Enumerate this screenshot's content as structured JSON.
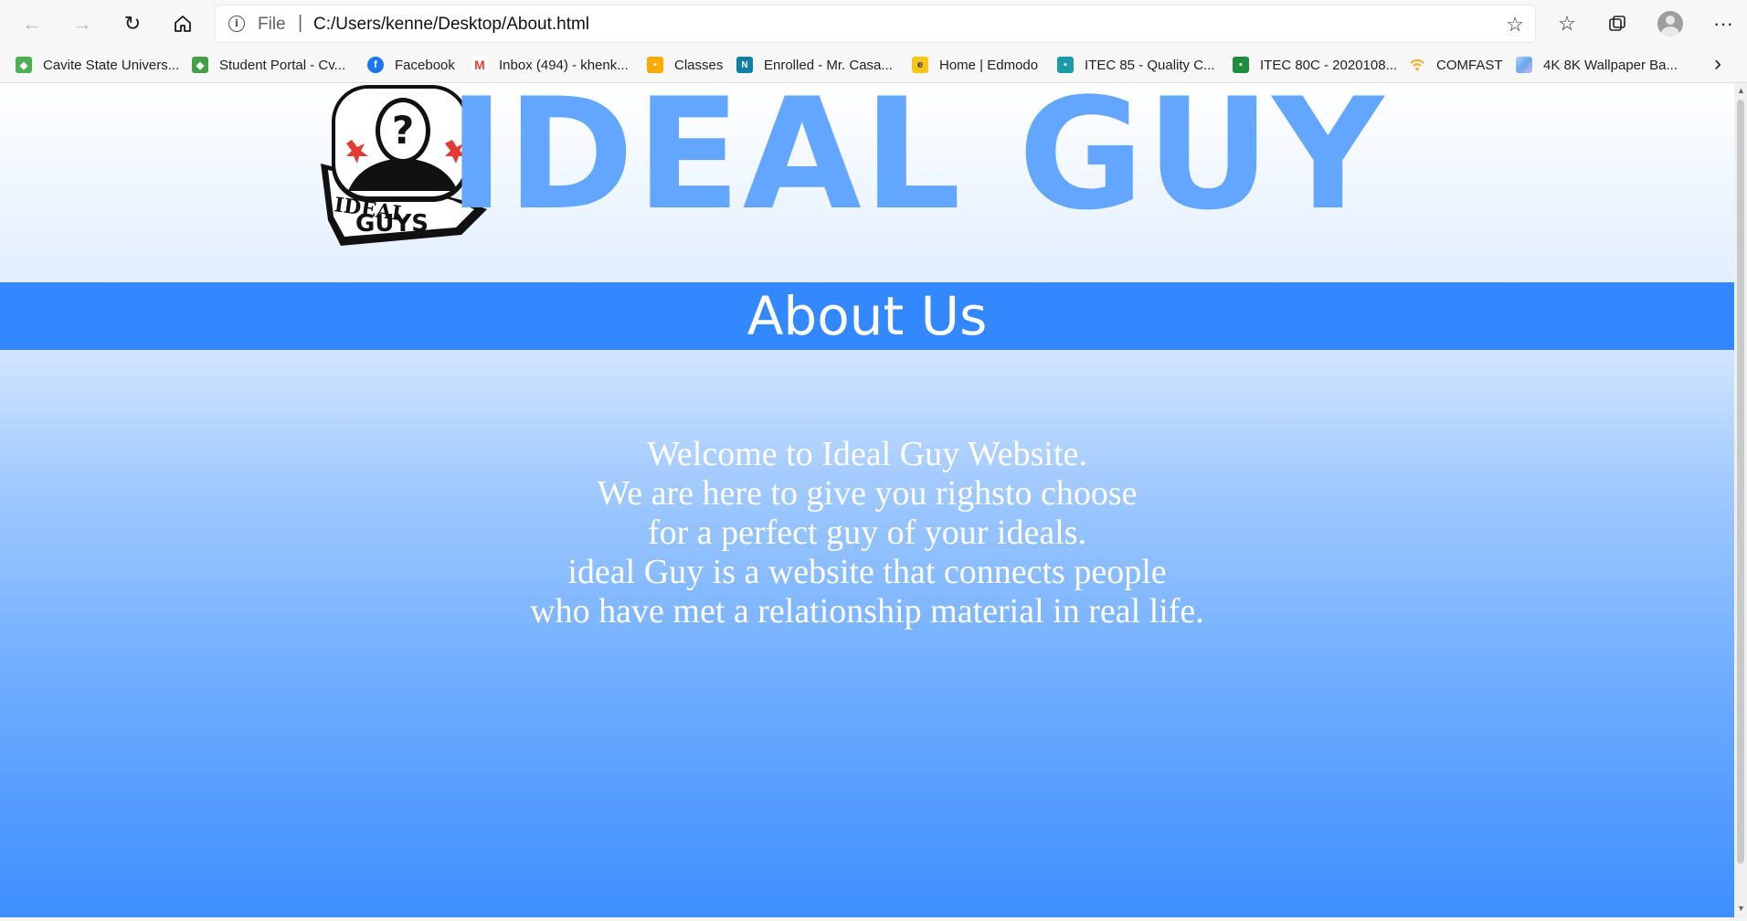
{
  "browser": {
    "address": {
      "scheme": "File",
      "separator": "|",
      "url": "C:/Users/kenne/Desktop/About.html"
    },
    "icons": {
      "back": "back-arrow-icon",
      "forward": "forward-arrow-icon",
      "refresh": "refresh-icon",
      "home": "home-icon",
      "info": "info-icon",
      "add_favorite": "star-add-icon",
      "favorites": "favorites-icon",
      "collections": "collections-icon",
      "profile": "profile-avatar-icon",
      "menu": "more-menu-icon"
    },
    "favorites": [
      {
        "label": "Cavite State Univers...",
        "icon": "cvsu-icon",
        "color": "#4caf50"
      },
      {
        "label": "Student Portal - Cv...",
        "icon": "portal-icon",
        "color": "#43a047"
      },
      {
        "label": "Facebook",
        "icon": "facebook-icon",
        "color": "#1877f2"
      },
      {
        "label": "Inbox (494) - khenk...",
        "icon": "gmail-icon",
        "color": "#ea4335"
      },
      {
        "label": "Classes",
        "icon": "classroom-icon",
        "color": "#f9ab00"
      },
      {
        "label": "Enrolled - Mr. Casa...",
        "icon": "onenote-icon",
        "color": "#0f7fa6"
      },
      {
        "label": "Home | Edmodo",
        "icon": "edmodo-icon",
        "color": "#f5c518"
      },
      {
        "label": "ITEC 85 - Quality C...",
        "icon": "classroom-icon",
        "color": "#1b9aaa"
      },
      {
        "label": "ITEC 80C - 2020108...",
        "icon": "classroom-icon",
        "color": "#1e8e3e"
      },
      {
        "label": "COMFAST",
        "icon": "wifi-icon",
        "color": "#f5a623"
      },
      {
        "label": "4K 8K Wallpaper Ba...",
        "icon": "wallpaper-icon",
        "color": "#7fb2e5"
      }
    ]
  },
  "page": {
    "logo": {
      "line1": "IDEAL",
      "line2": "GUYS",
      "mark": "?"
    },
    "brand_title": "IDEAL GUY",
    "about_heading": "About Us",
    "welcome_lines": [
      "Welcome to Ideal Guy Website.",
      "We are here to give you righsto choose",
      "for a perfect guy of your ideals.",
      "ideal Guy is a website that connects people",
      "who have met a relationship material in real life."
    ]
  },
  "colors": {
    "brand_blue": "#63a6ff",
    "banner_blue": "#3388ff"
  }
}
